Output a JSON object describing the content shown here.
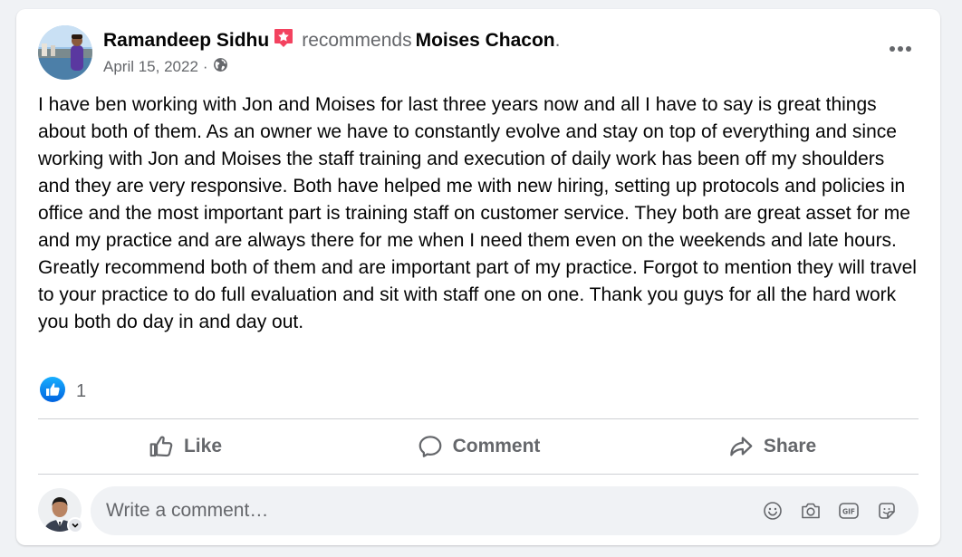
{
  "post": {
    "author": "Ramandeep Sidhu",
    "verb": "recommends",
    "target": "Moises Chacon",
    "period": ".",
    "date": "April 15, 2022",
    "separator": "·",
    "audience_icon": "globe-icon",
    "body": "I have ben working with Jon and Moises for last three years now and all I have to say is great things about both of them. As an owner we have to constantly evolve and stay on top of everything and since working with Jon and Moises the staff training and execution of daily work has been off my shoulders and they are very responsive. Both have helped me with new hiring, setting up protocols and policies in office and the most important part is training staff on customer service. They both are great asset for me and my practice and are always there for me when I need them even on the weekends and late hours. Greatly recommend both of them and are important part of my practice. Forgot to mention they will travel to your practice to do full evaluation and sit with staff one on one. Thank you guys for all the hard work you both do day in and day out."
  },
  "reactions": {
    "icon": "like-reaction-icon",
    "count": "1"
  },
  "actions": {
    "like": "Like",
    "comment": "Comment",
    "share": "Share"
  },
  "comment": {
    "placeholder": "Write a comment…",
    "icons": [
      "emoji-icon",
      "camera-icon",
      "gif-icon",
      "sticker-icon"
    ]
  },
  "colors": {
    "accent": "#1877f2",
    "secondary_text": "#65676b",
    "badge": "#f3425f",
    "background": "#f0f2f5"
  }
}
